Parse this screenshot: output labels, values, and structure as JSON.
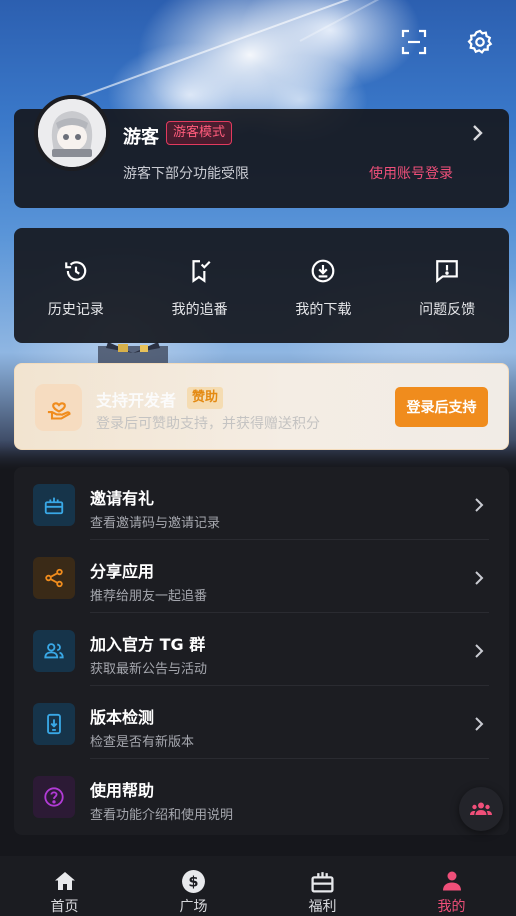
{
  "colors": {
    "accent": "#ef4f79",
    "orange": "#f08c1d",
    "card": "#1c1d22"
  },
  "topbar": {
    "scan_icon": "scan-icon",
    "settings_icon": "gear-icon"
  },
  "profile": {
    "name": "游客",
    "badge": "游客模式",
    "subtitle": "游客下部分功能受限",
    "login_link": "使用账号登录"
  },
  "quick_actions": [
    {
      "label": "历史记录",
      "icon": "history-icon"
    },
    {
      "label": "我的追番",
      "icon": "bookmark-check-icon"
    },
    {
      "label": "我的下载",
      "icon": "download-icon"
    },
    {
      "label": "问题反馈",
      "icon": "feedback-icon"
    }
  ],
  "support": {
    "title": "支持开发者",
    "tag": "赞助",
    "subtitle": "登录后可赞助支持，并获得赠送积分",
    "button": "登录后支持"
  },
  "menu": [
    {
      "title": "邀请有礼",
      "subtitle": "查看邀请码与邀请记录",
      "icon": "gift-icon"
    },
    {
      "title": "分享应用",
      "subtitle": "推荐给朋友一起追番",
      "icon": "share-icon"
    },
    {
      "title": "加入官方 TG 群",
      "subtitle": "获取最新公告与活动",
      "icon": "group-icon"
    },
    {
      "title": "版本检测",
      "subtitle": "检查是否有新版本",
      "icon": "phone-update-icon"
    },
    {
      "title": "使用帮助",
      "subtitle": "查看功能介绍和使用说明",
      "icon": "help-icon"
    }
  ],
  "nav": [
    {
      "label": "首页",
      "icon": "home-icon"
    },
    {
      "label": "广场",
      "icon": "dollar-icon"
    },
    {
      "label": "福利",
      "icon": "gift-box-icon"
    },
    {
      "label": "我的",
      "icon": "person-icon",
      "active": true
    }
  ]
}
